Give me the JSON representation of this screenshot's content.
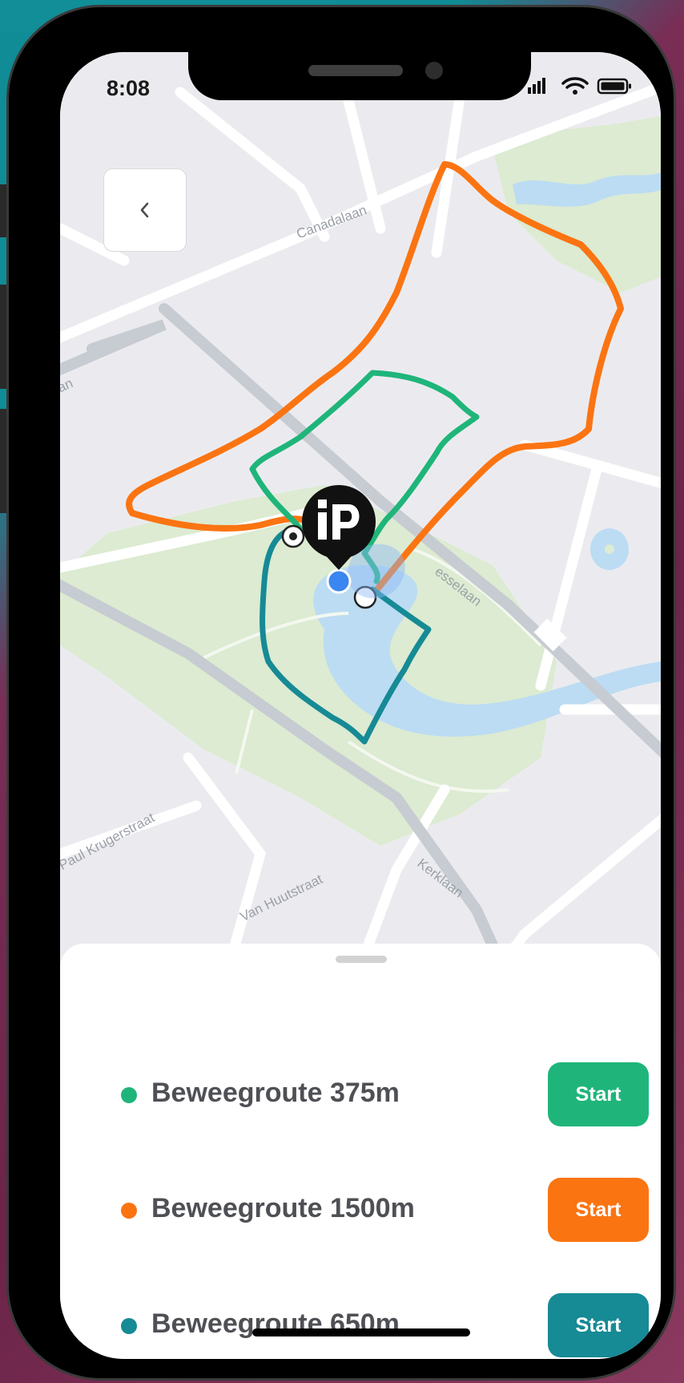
{
  "status_bar": {
    "time": "8:08",
    "icons": [
      "signal-icon",
      "wifi-icon",
      "battery-icon"
    ]
  },
  "map": {
    "back_icon": "chevron-left-icon",
    "street_labels": [
      "Canadalaan",
      "Paul Krugerstraat",
      "Van Huutstraat",
      "Kerklaan",
      "esselaan",
      "an"
    ],
    "marker_logo": "iP"
  },
  "routes": [
    {
      "name": "Beweegroute 375m",
      "color": "#1fb57a",
      "button_label": "Start"
    },
    {
      "name": "Beweegroute 1500m",
      "color": "#fb7412",
      "button_label": "Start"
    },
    {
      "name": "Beweegroute 650m",
      "color": "#168a95",
      "button_label": "Start"
    }
  ],
  "colors": {
    "map_background": "#ebebef",
    "park": "#dcebd1",
    "water": "#bcdcf3",
    "road": "#ffffff",
    "major_road": "#c7cbd2",
    "location_dot": "#3b86f0"
  }
}
